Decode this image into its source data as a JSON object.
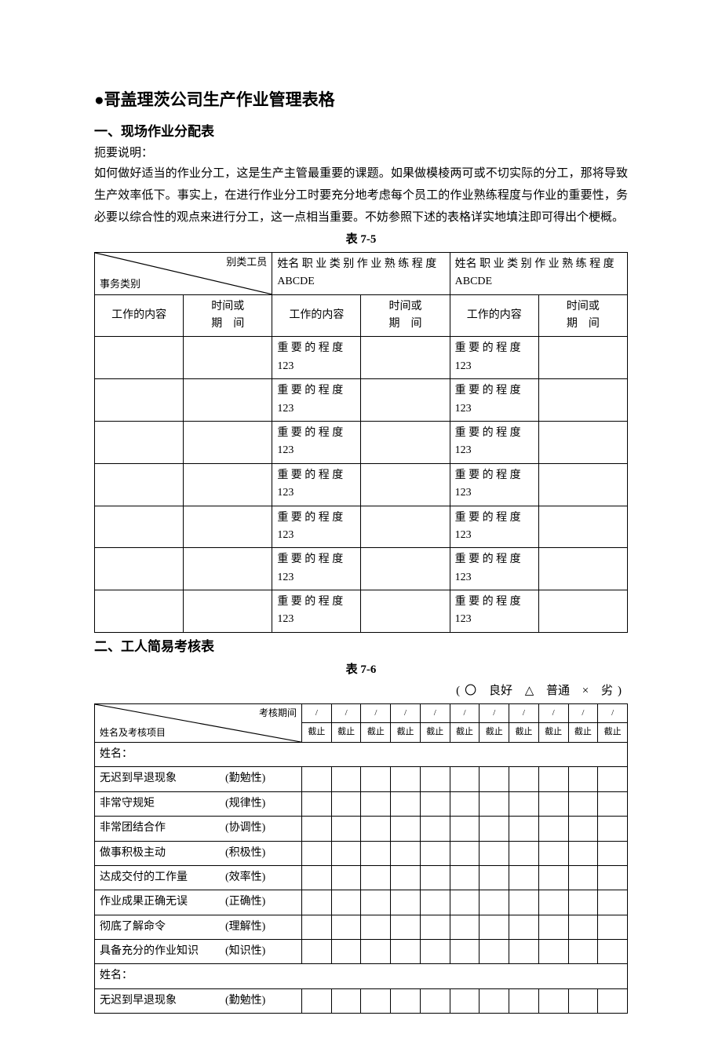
{
  "title": "●哥盖理茨公司生产作业管理表格",
  "section1": {
    "heading": "一、现场作业分配表",
    "summary_label": "扼要说明：",
    "body": "如何做好适当的作业分工，这是生产主管最重要的课题。如果做模棱两可或不切实际的分工，那将导致生产效率低下。事实上，在进行作业分工时要充分地考虑每个员工的作业熟练程度与作业的重要性，务必要以综合性的观点来进行分工，这一点相当重要。不妨参照下述的表格详实地填注即可得出个梗概。"
  },
  "table75": {
    "caption": "表 7-5",
    "diag_top": "别类工员",
    "diag_bottom": "事务类别",
    "header_col_a": "姓名 职 业 类 别 作 业 熟 练 程 度ABCDE",
    "header_col_b": "姓名 职 业 类 别 作 业 熟 练 程 度ABCDE",
    "work_content": "工作的内容",
    "time_or_period": "时间或\n期　间",
    "importance": "重 要 的 程 度123",
    "row_count": 7
  },
  "section2": {
    "heading": "二、工人简易考核表"
  },
  "table76": {
    "caption": "表 7-6",
    "legend": {
      "circle": "〇",
      "good": "良好",
      "triangle": "△",
      "normal": "普通",
      "cross": "×",
      "bad": "劣"
    },
    "diag_top": "考核期间",
    "diag_bottom": "姓名及考核项目",
    "period_slash": "/",
    "period_end": "截止",
    "period_count": 11,
    "name_label": "姓名：",
    "items": [
      {
        "desc": "无迟到早退现象",
        "attr": "(勤勉性)"
      },
      {
        "desc": "非常守规矩",
        "attr": "(规律性)"
      },
      {
        "desc": "非常团结合作",
        "attr": "(协调性)"
      },
      {
        "desc": "做事积极主动",
        "attr": "(积极性)"
      },
      {
        "desc": "达成交付的工作量",
        "attr": "(效率性)"
      },
      {
        "desc": "作业成果正确无误",
        "attr": "(正确性)"
      },
      {
        "desc": "彻底了解命令",
        "attr": "(理解性)"
      },
      {
        "desc": "具备充分的作业知识",
        "attr": "(知识性)"
      }
    ],
    "items2": [
      {
        "desc": "无迟到早退现象",
        "attr": "(勤勉性)"
      }
    ]
  }
}
